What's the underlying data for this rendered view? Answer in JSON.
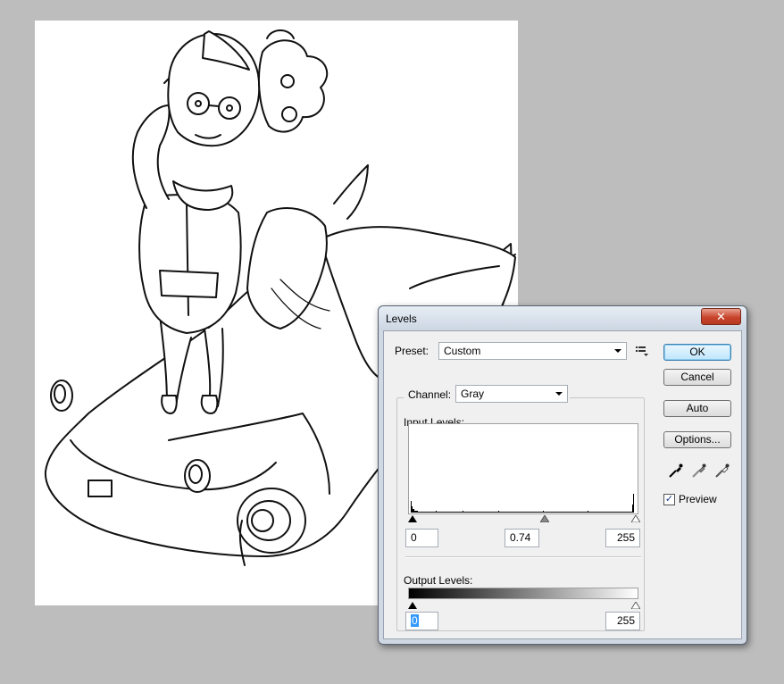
{
  "dialog": {
    "title": "Levels",
    "close_label": "✕",
    "preset_label": "Preset:",
    "preset_value": "Custom",
    "channel_label": "Channel:",
    "channel_value": "Gray",
    "input_levels_label": "Input Levels:",
    "input_black": "0",
    "input_gamma": "0.74",
    "input_white": "255",
    "output_levels_label": "Output Levels:",
    "output_black": "0",
    "output_white": "255",
    "buttons": {
      "ok": "OK",
      "cancel": "Cancel",
      "auto": "Auto",
      "options": "Options..."
    },
    "preview_label": "Preview",
    "preview_checked": true
  },
  "icons": {
    "preset_menu": "preset-options-icon",
    "close": "close-icon",
    "eyedroppers": [
      "black-eyedropper-icon",
      "gray-eyedropper-icon",
      "white-eyedropper-icon"
    ]
  }
}
